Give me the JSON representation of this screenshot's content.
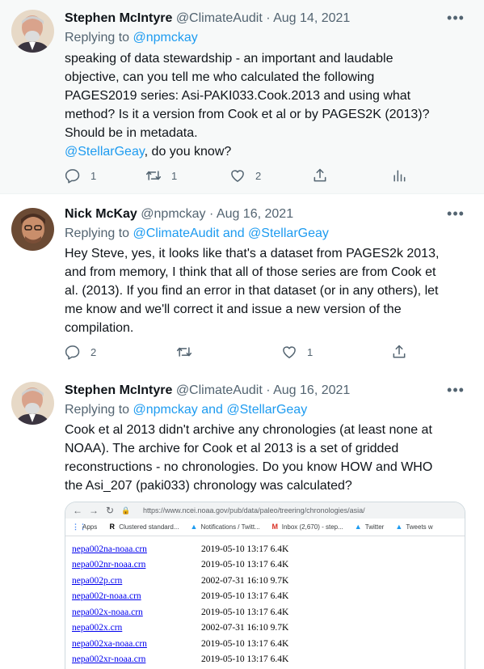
{
  "tweets": [
    {
      "name": "Stephen McIntyre",
      "handle": "@ClimateAudit",
      "date": "Aug 14, 2021",
      "reply_prefix": "Replying to ",
      "reply_mentions": "@npmckay",
      "reply_join": "",
      "reply_mentions2": "",
      "lines": [
        "speaking of data stewardship - an important and laudable",
        "objective, can you tell me who calculated the following",
        "PAGES2019 series: Asi-PAKI033.Cook.2013 and using what",
        "method? Is it a version from Cook et al or by PAGES2K (2013)?",
        "Should be in metadata."
      ],
      "tail_mention": "@StellarGeay",
      "tail_text": ", do you know?",
      "replies": "1",
      "retweets": "1",
      "likes": "2"
    },
    {
      "name": "Nick McKay",
      "handle": "@npmckay",
      "date": "Aug 16, 2021",
      "reply_prefix": "Replying to ",
      "reply_mentions": "@ClimateAudit",
      "reply_join": " and ",
      "reply_mentions2": "@StellarGeay",
      "lines": [
        "Hey Steve, yes, it looks like that's a dataset from PAGES2k 2013,",
        "and from memory, I think that all of those series are from Cook et",
        "al. (2013). If you find an error in that dataset (or in any others), let",
        "me know and we'll correct it and issue a new version of the",
        "compilation."
      ],
      "replies": "2",
      "likes": "1"
    },
    {
      "name": "Stephen McIntyre",
      "handle": "@ClimateAudit",
      "date": "Aug 16, 2021",
      "reply_prefix": "Replying to ",
      "reply_mentions": "@npmckay",
      "reply_join": " and ",
      "reply_mentions2": "@StellarGeay",
      "lines": [
        "Cook et al 2013 didn't archive any chronologies (at least none at",
        "NOAA). The archive for Cook et al 2013 is a set of gridded",
        "reconstructions - no chronologies. Do you know HOW and WHO",
        "the Asi_207 (paki033) chronology was calculated?"
      ]
    }
  ],
  "separator": " · ",
  "embed": {
    "url": "https://www.ncei.noaa.gov/pub/data/paleo/treering/chronologies/asia/",
    "bookmarks": [
      "Apps",
      "Clustered standard...",
      "Notifications / Twitt...",
      "Inbox (2,670) - step...",
      "Twitter",
      "Tweets w"
    ],
    "files": [
      {
        "name": "nepa002na-noaa.crn",
        "date": "2019-05-10 13:17",
        "size": "6.4K"
      },
      {
        "name": "nepa002nr-noaa.crn",
        "date": "2019-05-10 13:17",
        "size": "6.4K"
      },
      {
        "name": "nepa002p.crn",
        "date": "2002-07-31 16:10",
        "size": "9.7K"
      },
      {
        "name": "nepa002r-noaa.crn",
        "date": "2019-05-10 13:17",
        "size": "6.4K"
      },
      {
        "name": "nepa002x-noaa.crn",
        "date": "2019-05-10 13:17",
        "size": "6.4K"
      },
      {
        "name": "nepa002x.crn",
        "date": "2002-07-31 16:10",
        "size": "9.7K"
      },
      {
        "name": "nepa002xa-noaa.crn",
        "date": "2019-05-10 13:17",
        "size": "6.4K"
      },
      {
        "name": "nepa002xr-noaa.crn",
        "date": "2019-05-10 13:17",
        "size": "6.4K"
      }
    ]
  },
  "colors": {
    "accent": "#1d9bf0",
    "muted": "#536471",
    "link": "#0000ee",
    "highlight_bg": "#f7f9f9"
  },
  "icons": [
    "reply-icon",
    "retweet-icon",
    "like-icon",
    "share-icon",
    "analytics-icon",
    "more-icon"
  ]
}
